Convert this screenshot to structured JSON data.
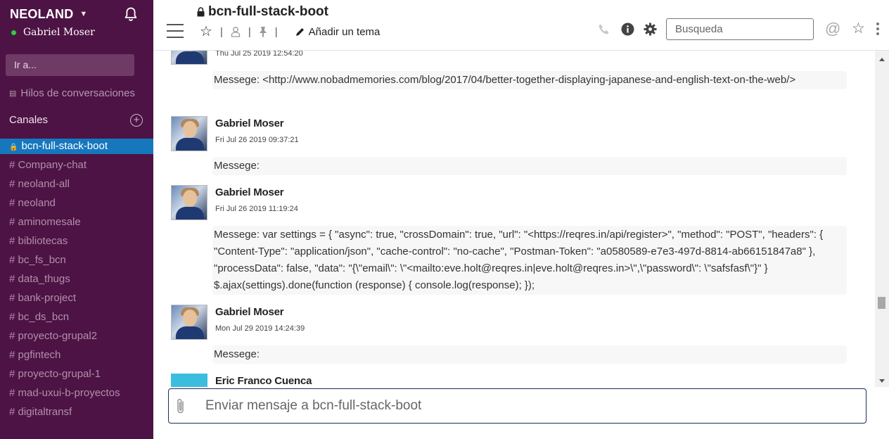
{
  "workspace": {
    "name": "NEOLAND",
    "user": "Gabriel Moser",
    "goto_placeholder": "Ir a...",
    "threads_label": "Hilos de conversaciones",
    "channels_header": "Canales",
    "active_channel": "bcn-full-stack-boot",
    "channels": [
      "# Company-chat",
      "# neoland-all",
      "# neoland",
      "# aminomesale",
      "# bibliotecas",
      "# bc_fs_bcn",
      "# data_thugs",
      "# bank-project",
      "# bc_ds_bcn",
      "# proyecto-grupal2",
      "# pgfintech",
      "# proyecto-grupal-1",
      "# mad-uxui-b-proyectos",
      "# digitaltransf"
    ]
  },
  "header": {
    "room_title": "bcn-full-stack-boot",
    "add_topic": "Añadir un tema",
    "separator": "|",
    "search_placeholder": "Busqueda",
    "at_symbol": "@"
  },
  "messages": [
    {
      "author": "",
      "timestamp": "Thu Jul 25 2019 12:54:20",
      "body": "Messege: <http://www.nobadmemories.com/blog/2017/04/better-together-displaying-japanese-and-english-text-on-the-web/>"
    },
    {
      "author": "Gabriel Moser",
      "timestamp": "Fri Jul 26 2019 09:37:21",
      "body": "Messege:"
    },
    {
      "author": "Gabriel Moser",
      "timestamp": "Fri Jul 26 2019 11:19:24",
      "body": "Messege: var settings = { \"async\": true, \"crossDomain\": true, \"url\": \"<https://reqres.in/api/register>\", \"method\": \"POST\", \"headers\": { \"Content-Type\": \"application/json\", \"cache-control\": \"no-cache\", \"Postman-Token\": \"a0580589-e7e3-497d-8814-ab66151847a8\" }, \"processData\": false, \"data\": \"{\\\"email\\\": \\\"<mailto:eve.holt@reqres.in|eve.holt@reqres.in>\\\",\\\"password\\\": \\\"safsfasf\\\"}\" } $.ajax(settings).done(function (response) { console.log(response); });"
    },
    {
      "author": "Gabriel Moser",
      "timestamp": "Mon Jul 29 2019 14:24:39",
      "body": "Messege:"
    },
    {
      "author": "Eric Franco Cuenca",
      "timestamp": "",
      "body": ""
    }
  ],
  "composer": {
    "placeholder": "Enviar mensaje a bcn-full-stack-boot"
  },
  "colors": {
    "sidebar_bg": "#4d1344",
    "active_channel_bg": "#1677bd",
    "online": "#2ecc40"
  }
}
